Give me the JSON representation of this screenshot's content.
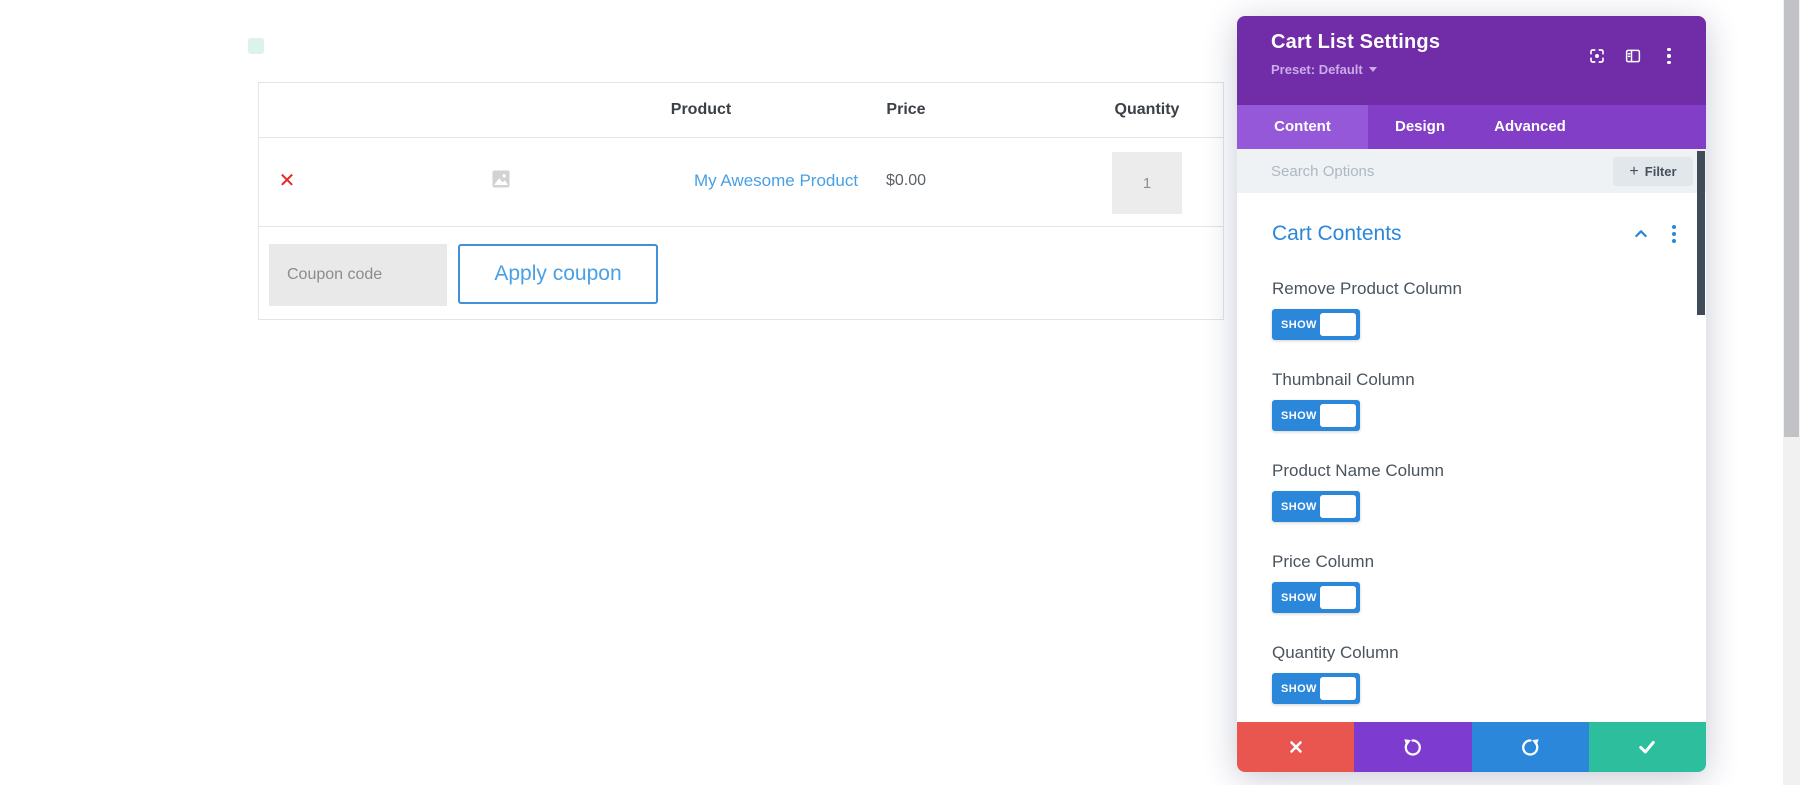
{
  "page": {
    "cart_table": {
      "headers": {
        "product": "Product",
        "price": "Price",
        "quantity": "Quantity"
      },
      "row": {
        "remove_glyph": "✕",
        "product_name": "My Awesome Product",
        "price": "$0.00",
        "quantity": "1"
      },
      "coupon_placeholder": "Coupon code",
      "apply_coupon_label": "Apply coupon"
    }
  },
  "modal": {
    "title": "Cart List Settings",
    "preset_label": "Preset: Default",
    "tabs": [
      {
        "label": "Content",
        "active": true
      },
      {
        "label": "Design",
        "active": false
      },
      {
        "label": "Advanced",
        "active": false
      }
    ],
    "search_placeholder": "Search Options",
    "filter_button": {
      "plus": "+",
      "label": "Filter"
    },
    "section": {
      "title": "Cart Contents"
    },
    "toggles": [
      {
        "label": "Remove Product Column",
        "state": "SHOW"
      },
      {
        "label": "Thumbnail Column",
        "state": "SHOW"
      },
      {
        "label": "Product Name Column",
        "state": "SHOW"
      },
      {
        "label": "Price Column",
        "state": "SHOW"
      },
      {
        "label": "Quantity Column",
        "state": "SHOW"
      }
    ],
    "icons": {
      "header": [
        "expand-icon",
        "split-view-icon",
        "kebab-menu-icon"
      ],
      "section": [
        "chevron-up-icon",
        "kebab-menu-icon"
      ],
      "footer": [
        "close-icon",
        "undo-icon",
        "redo-icon",
        "check-icon"
      ]
    },
    "colors": {
      "header_purple": "#712CA8",
      "tabbar_purple": "#823EC6",
      "active_tab_purple": "#9458D8",
      "accent_blue": "#2B87DA",
      "link_blue": "#4AA0E4",
      "remove_red": "#E3272B",
      "footer_red": "#E8564F",
      "footer_purple": "#7E3BD0",
      "footer_blue": "#2B87DA",
      "footer_green": "#2CBE9D"
    }
  }
}
